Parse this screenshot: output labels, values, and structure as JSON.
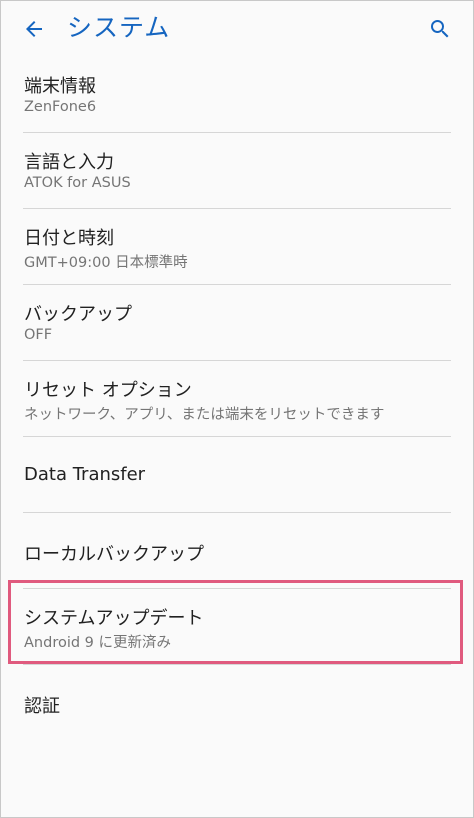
{
  "appbar": {
    "title": "システム",
    "back_icon": "arrow-back-icon",
    "search_icon": "search-icon",
    "accent_color": "#1565c0"
  },
  "items": [
    {
      "title": "端末情報",
      "subtitle": "ZenFone6"
    },
    {
      "title": "言語と入力",
      "subtitle": "ATOK for ASUS"
    },
    {
      "title": "日付と時刻",
      "subtitle": "GMT+09:00 日本標準時"
    },
    {
      "title": "バックアップ",
      "subtitle": "OFF"
    },
    {
      "title": "リセット オプション",
      "subtitle": "ネットワーク、アプリ、または端末をリセットできます"
    },
    {
      "title": "Data Transfer"
    },
    {
      "title": "ローカルバックアップ"
    },
    {
      "title": "システムアップデート",
      "subtitle": "Android 9 に更新済み"
    },
    {
      "title": "認証"
    }
  ],
  "highlight": {
    "target": "システムアップデート",
    "color": "#e05a7e"
  }
}
